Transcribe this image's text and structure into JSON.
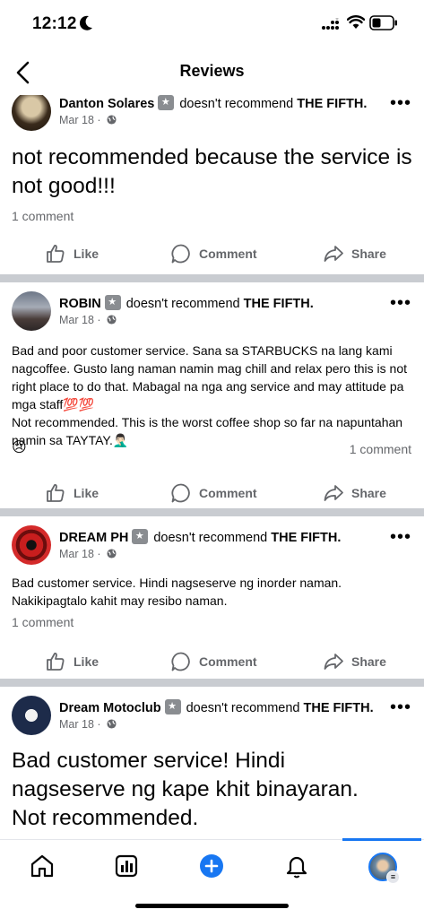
{
  "status": {
    "time": "12:12"
  },
  "nav": {
    "title": "Reviews"
  },
  "posts": [
    {
      "author": "Danton Solares",
      "verb": "doesn't recommend",
      "page": "THE FIFTH.",
      "date": "Mar 18 ·",
      "body": "not recommended because the service is not good!!!",
      "comments": "1 comment"
    },
    {
      "author": "ROBIN",
      "verb": "doesn't recommend",
      "page": "THE FIFTH.",
      "date": "Mar 18 ·",
      "body": "Bad and poor customer service. Sana sa STARBUCKS na lang kami nagcoffee. Gusto lang naman namin mag chill and relax pero this is not right place to do that. Mabagal na nga ang service and may attitude pa mga staff💯💯\nNot recommended. This is the worst coffee shop so far na napuntahan namin sa TAYTAY.🤦🏻‍♂️",
      "reaction_emoji": "😢",
      "comments": "1 comment"
    },
    {
      "author": "DREAM PH",
      "verb": "doesn't recommend",
      "page": "THE FIFTH.",
      "date": "Mar 18 ·",
      "body": "Bad customer service. Hindi nagseserve ng inorder naman. Nakikipagtalo kahit may resibo naman.",
      "comments": "1 comment"
    },
    {
      "author": "Dream Motoclub",
      "verb": "doesn't recommend",
      "page": "THE FIFTH.",
      "date": "Mar 18 ·",
      "body": "Bad customer service! Hindi nagseserve ng kape khit binayaran. Not recommended."
    }
  ],
  "actions": {
    "like": "Like",
    "comment": "Comment",
    "share": "Share"
  },
  "more_glyph": "•••",
  "colors": {
    "accent": "#1877f2",
    "divider": "#c9ccd1",
    "secondary_text": "#65676b"
  }
}
